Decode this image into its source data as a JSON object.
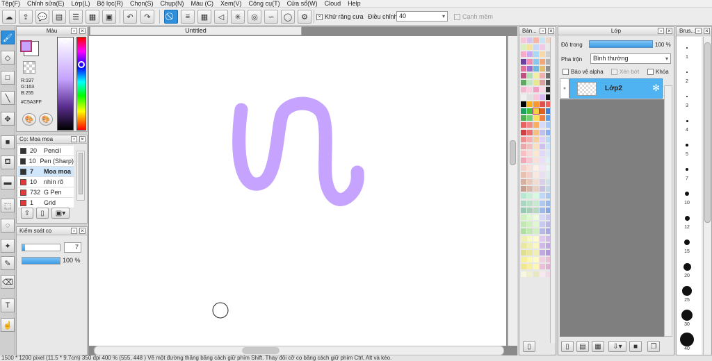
{
  "menu": [
    "Tệp(F)",
    "Chỉnh sửa(E)",
    "Lớp(L)",
    "Bộ lọc(R)",
    "Chọn(S)",
    "Chụp(N)",
    "Màu (C)",
    "Xem(V)",
    "Công cụ(T)",
    "Cửa sổ(W)",
    "Cloud",
    "Help"
  ],
  "toolbar": {
    "antialias_label": "Khử răng cưa",
    "adjust_label": "Điều chỉnh",
    "adjust_value": "40",
    "edge_label": "Cạnh mềm"
  },
  "color_panel": {
    "title": "Màu",
    "r": "R:197",
    "g": "G:163",
    "b": "B:255",
    "hex": "#C5A3FF",
    "fg_color": "#c5a3ff"
  },
  "brush_panel": {
    "title": "Cọ: Moa moa",
    "items": [
      {
        "size": "20",
        "name": "Pencil",
        "color": "#333333"
      },
      {
        "size": "10",
        "name": "Pen (Sharp)",
        "color": "#333333"
      },
      {
        "size": "7",
        "name": "Moa moa",
        "color": "#333333"
      },
      {
        "size": "10",
        "name": "nhìn rõ",
        "color": "#e03a3a"
      },
      {
        "size": "732",
        "name": "G Pen",
        "color": "#e03a3a"
      },
      {
        "size": "1",
        "name": "Grid",
        "color": "#e03a3a"
      }
    ]
  },
  "brush_control": {
    "title": "Kiểm soát cọ",
    "size_value": "7",
    "opacity_value": "100 %",
    "size_fraction": 0.07,
    "opacity_fraction": 1.0
  },
  "document": {
    "tab_title": "Untitled",
    "stroke_color": "#c5a3ff"
  },
  "palette_panel": {
    "title": "Bản..."
  },
  "layer_panel": {
    "title": "Lớp",
    "opacity_label": "Độ trong",
    "opacity_value": "100 %",
    "blend_label": "Pha trộn",
    "blend_value": "Bình thường",
    "protect_alpha": "Bảo vệ alpha",
    "clip": "Xén bớt",
    "lock": "Khóa",
    "layer_name": "Lớp2"
  },
  "brush_sizes": {
    "title": "Brus...",
    "sizes": [
      "1",
      "2",
      "3",
      "4",
      "5",
      "7",
      "10",
      "12",
      "15",
      "20",
      "25",
      "30",
      "40"
    ]
  },
  "status": "1500 * 1200 pixel (11.5 * 9.7cm) 350 dpi 400 % (555, 448 ) Vẽ một đường thẳng bằng cách giữ phím Shift. Thay đổi cỡ cọ bằng cách giữ phím Ctrl, Alt và kéo."
}
